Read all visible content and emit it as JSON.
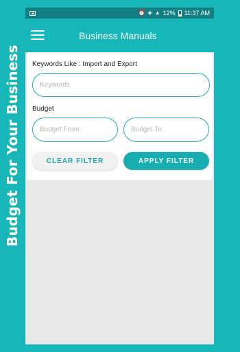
{
  "side_banner": {
    "text": "Budget For Your Business"
  },
  "status_bar": {
    "left_icon": "gallery-icon",
    "icons": [
      "alarm-icon",
      "wifi-icon",
      "signal-icon"
    ],
    "battery_text": "12%",
    "battery_icon": "battery-icon",
    "time": "11:37 AM"
  },
  "app_bar": {
    "title": "Business Manuals",
    "menu_icon": "menu-icon"
  },
  "filter": {
    "keywords_label": "Keywords Like : Import and Export",
    "keywords_placeholder": "Keywords",
    "budget_label": "Budget",
    "budget_from_placeholder": "Budget From",
    "budget_to_placeholder": "Budget To",
    "clear_label": "CLEAR FILTER",
    "apply_label": "APPLY FILTER"
  },
  "colors": {
    "teal": "#17b6b8",
    "teal_dark": "#137f82",
    "background": "#e8e8e8",
    "white": "#ffffff"
  }
}
